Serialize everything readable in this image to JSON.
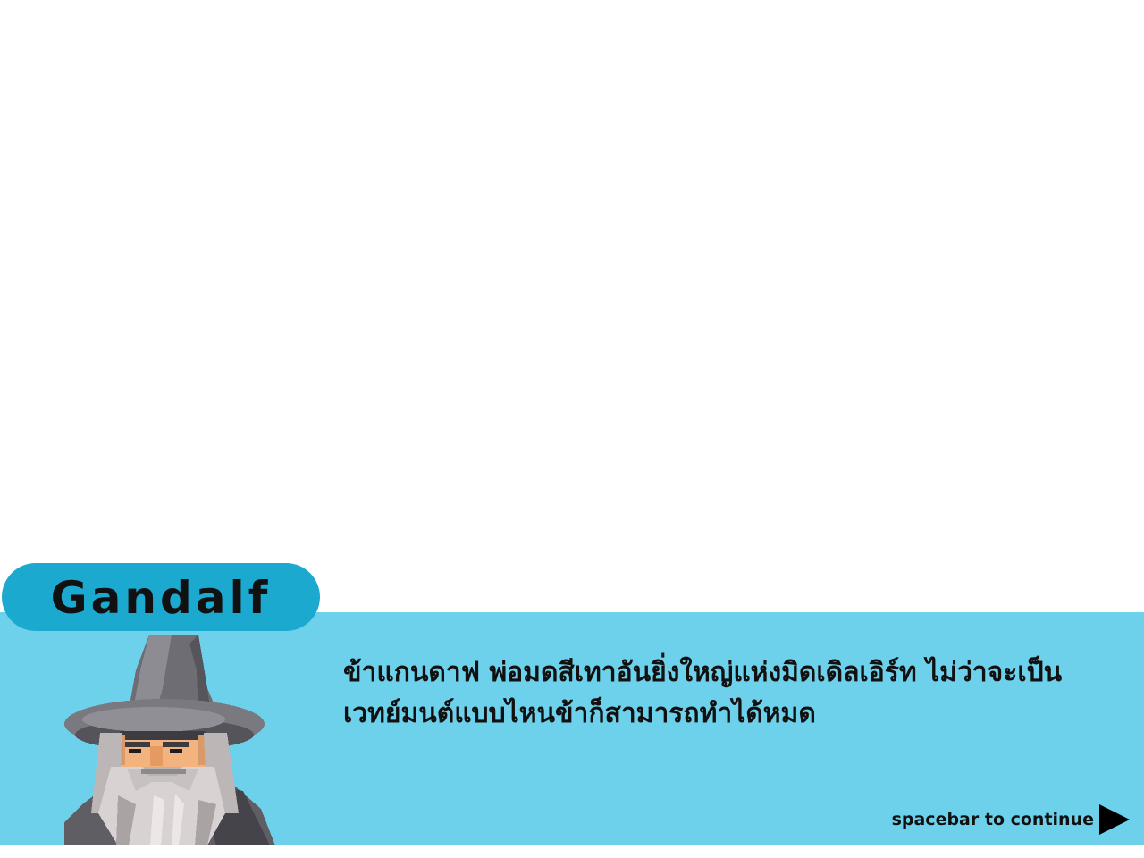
{
  "dialog": {
    "speaker_name": "Gandalf",
    "lines": [
      "ข้าแกนดาฟ พ่อมดสีเทาอันยิ่งใหญ่แห่งมิดเดิลเอิร์ท ไม่ว่าจะเป็น",
      "เวทย์มนต์แบบไหนข้าก็สามารถทำได้หมด"
    ],
    "continue_hint": "spacebar to continue"
  },
  "colors": {
    "panel": "#6dd1ec",
    "name_plate": "#1ba9cf",
    "text": "#111111"
  },
  "icons": {
    "portrait": "wizard-portrait",
    "continue": "play-arrow-icon"
  }
}
